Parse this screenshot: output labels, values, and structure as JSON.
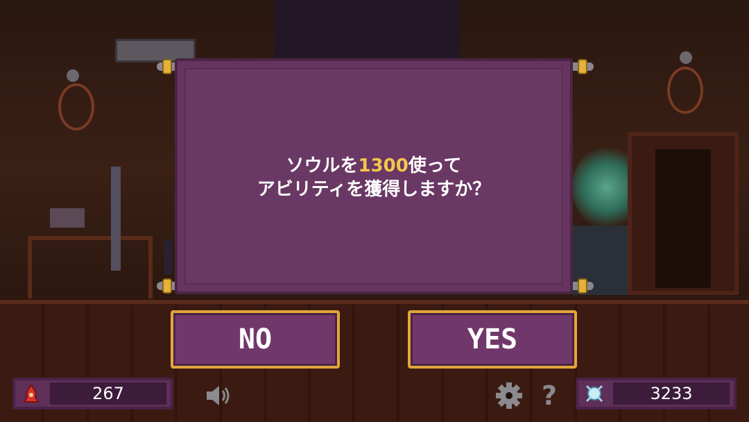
{
  "dialog": {
    "line1_before": "ソウルを",
    "cost": "1300",
    "line1_after": "使って",
    "line2": "アビリティを獲得しますか？"
  },
  "buttons": {
    "no_label": "NO",
    "yes_label": "YES"
  },
  "hud": {
    "soul_count": "267",
    "gem_count": "3233",
    "soul_icon": "red-flame-soul-icon",
    "gem_icon": "blue-crystal-icon",
    "sound_icon": "speaker-icon",
    "settings_icon": "gear-icon",
    "help_icon": "question-icon"
  },
  "colors": {
    "dialog_bg": "#66355f",
    "button_border": "#e2a63a",
    "cost_highlight": "#f2c84a"
  }
}
